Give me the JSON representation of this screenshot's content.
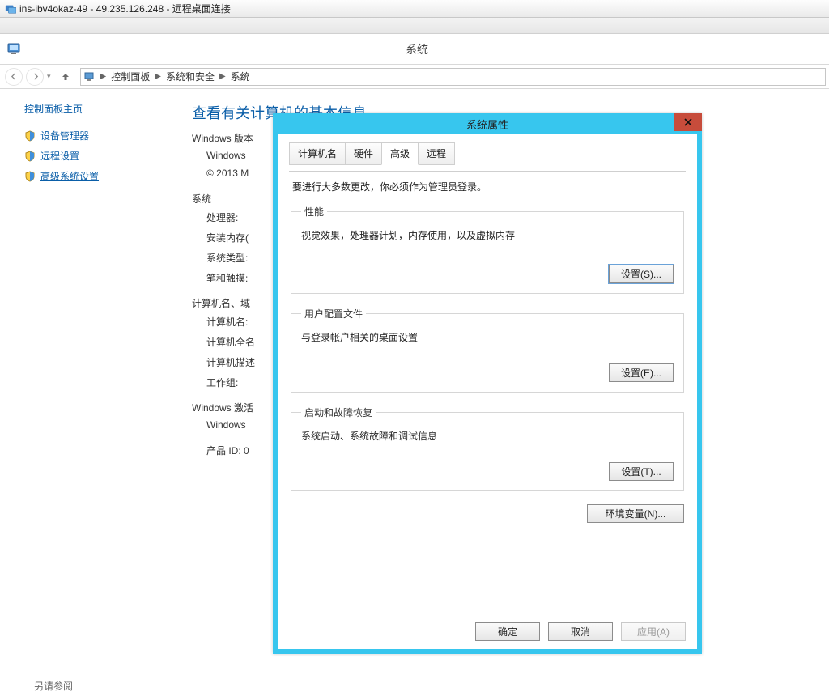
{
  "rdp": {
    "title": "ins-ibv4okaz-49 - 49.235.126.248 - 远程桌面连接"
  },
  "explorer": {
    "window_title": "系统",
    "breadcrumb": {
      "root": "控制面板",
      "mid": "系统和安全",
      "leaf": "系统"
    }
  },
  "sidebar": {
    "home": "控制面板主页",
    "items": [
      {
        "label": "设备管理器"
      },
      {
        "label": "远程设置"
      },
      {
        "label": "高级系统设置"
      }
    ]
  },
  "main": {
    "heading": "查看有关计算机的基本信息",
    "win_ver_title": "Windows 版本",
    "win_line1": "Windows",
    "win_line2": "© 2013 M",
    "system_title": "系统",
    "proc_label": "处理器:",
    "ram_label": "安装内存(",
    "type_label": "系统类型:",
    "pen_label": "笔和触摸:",
    "name_title": "计算机名、域",
    "cname_label": "计算机名:",
    "cfull_label": "计算机全名",
    "cdesc_label": "计算机描述",
    "wg_label": "工作组:",
    "act_title": "Windows 激活",
    "act_line": "Windows",
    "pid_label": "产品 ID: 0",
    "footer_also": "另请参阅"
  },
  "dialog": {
    "title": "系统属性",
    "tabs": {
      "t1": "计算机名",
      "t2": "硬件",
      "t3": "高级",
      "t4": "远程"
    },
    "admin_note": "要进行大多数更改，你必须作为管理员登录。",
    "grp1": {
      "legend": "性能",
      "desc": "视觉效果，处理器计划，内存使用，以及虚拟内存",
      "btn": "设置(S)..."
    },
    "grp2": {
      "legend": "用户配置文件",
      "desc": "与登录帐户相关的桌面设置",
      "btn": "设置(E)..."
    },
    "grp3": {
      "legend": "启动和故障恢复",
      "desc": "系统启动、系统故障和调试信息",
      "btn": "设置(T)..."
    },
    "env_btn": "环境变量(N)...",
    "ok": "确定",
    "cancel": "取消",
    "apply": "应用(A)"
  }
}
